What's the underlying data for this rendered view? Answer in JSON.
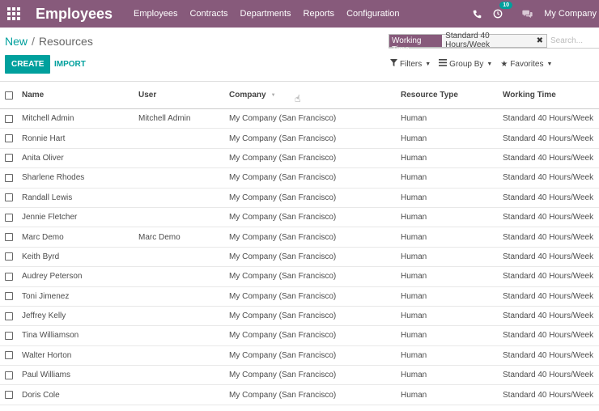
{
  "navbar": {
    "app_title": "Employees",
    "menu": [
      "Employees",
      "Contracts",
      "Departments",
      "Reports",
      "Configuration"
    ],
    "activity_count": "10",
    "company": "My Company",
    "bg_color": "#875a7b"
  },
  "breadcrumb": {
    "parent": "New",
    "separator": "/",
    "current": "Resources"
  },
  "buttons": {
    "create": "CREATE",
    "import": "IMPORT"
  },
  "search": {
    "facet_label": "Working Time",
    "facet_value": "Standard 40 Hours/Week",
    "placeholder": "Search..."
  },
  "filters": {
    "filters": "Filters",
    "group_by": "Group By",
    "favorites": "Favorites"
  },
  "table": {
    "columns": [
      "Name",
      "User",
      "Company",
      "Resource Type",
      "Working Time"
    ],
    "rows": [
      {
        "name": "Mitchell Admin",
        "user": "Mitchell Admin",
        "company": "My Company (San Francisco)",
        "type": "Human",
        "time": "Standard 40 Hours/Week"
      },
      {
        "name": "Ronnie Hart",
        "user": "",
        "company": "My Company (San Francisco)",
        "type": "Human",
        "time": "Standard 40 Hours/Week"
      },
      {
        "name": "Anita Oliver",
        "user": "",
        "company": "My Company (San Francisco)",
        "type": "Human",
        "time": "Standard 40 Hours/Week"
      },
      {
        "name": "Sharlene Rhodes",
        "user": "",
        "company": "My Company (San Francisco)",
        "type": "Human",
        "time": "Standard 40 Hours/Week"
      },
      {
        "name": "Randall Lewis",
        "user": "",
        "company": "My Company (San Francisco)",
        "type": "Human",
        "time": "Standard 40 Hours/Week"
      },
      {
        "name": "Jennie Fletcher",
        "user": "",
        "company": "My Company (San Francisco)",
        "type": "Human",
        "time": "Standard 40 Hours/Week"
      },
      {
        "name": "Marc Demo",
        "user": "Marc Demo",
        "company": "My Company (San Francisco)",
        "type": "Human",
        "time": "Standard 40 Hours/Week"
      },
      {
        "name": "Keith Byrd",
        "user": "",
        "company": "My Company (San Francisco)",
        "type": "Human",
        "time": "Standard 40 Hours/Week"
      },
      {
        "name": "Audrey Peterson",
        "user": "",
        "company": "My Company (San Francisco)",
        "type": "Human",
        "time": "Standard 40 Hours/Week"
      },
      {
        "name": "Toni Jimenez",
        "user": "",
        "company": "My Company (San Francisco)",
        "type": "Human",
        "time": "Standard 40 Hours/Week"
      },
      {
        "name": "Jeffrey Kelly",
        "user": "",
        "company": "My Company (San Francisco)",
        "type": "Human",
        "time": "Standard 40 Hours/Week"
      },
      {
        "name": "Tina Williamson",
        "user": "",
        "company": "My Company (San Francisco)",
        "type": "Human",
        "time": "Standard 40 Hours/Week"
      },
      {
        "name": "Walter Horton",
        "user": "",
        "company": "My Company (San Francisco)",
        "type": "Human",
        "time": "Standard 40 Hours/Week"
      },
      {
        "name": "Paul Williams",
        "user": "",
        "company": "My Company (San Francisco)",
        "type": "Human",
        "time": "Standard 40 Hours/Week"
      },
      {
        "name": "Doris Cole",
        "user": "",
        "company": "My Company (San Francisco)",
        "type": "Human",
        "time": "Standard 40 Hours/Week"
      }
    ]
  }
}
